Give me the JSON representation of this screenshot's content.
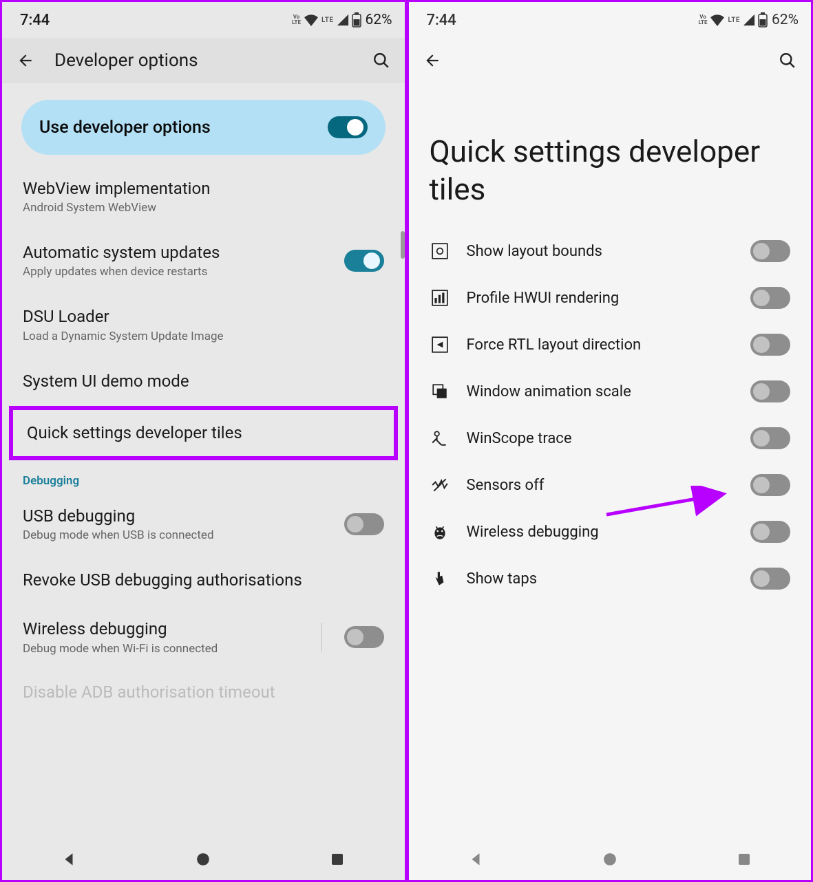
{
  "status": {
    "time": "7:44",
    "volte": "Vo\nLTE",
    "lte": "LTE",
    "battery_pct": "62%"
  },
  "left": {
    "app_title": "Developer options",
    "pill_label": "Use developer options",
    "rows": [
      {
        "title": "WebView implementation",
        "sub": "Android System WebView"
      },
      {
        "title": "Automatic system updates",
        "sub": "Apply updates when device restarts"
      },
      {
        "title": "DSU Loader",
        "sub": "Load a Dynamic System Update Image"
      },
      {
        "title": "System UI demo mode"
      },
      {
        "title": "Quick settings developer tiles"
      }
    ],
    "section": "Debugging",
    "debug_rows": [
      {
        "title": "USB debugging",
        "sub": "Debug mode when USB is connected"
      },
      {
        "title": "Revoke USB debugging authorisations"
      },
      {
        "title": "Wireless debugging",
        "sub": "Debug mode when Wi-Fi is connected"
      },
      {
        "title": "Disable ADB authorisation timeout"
      }
    ]
  },
  "right": {
    "big_title": "Quick settings developer tiles",
    "tiles": [
      "Show layout bounds",
      "Profile HWUI rendering",
      "Force RTL layout direction",
      "Window animation scale",
      "WinScope trace",
      "Sensors off",
      "Wireless debugging",
      "Show taps"
    ]
  }
}
